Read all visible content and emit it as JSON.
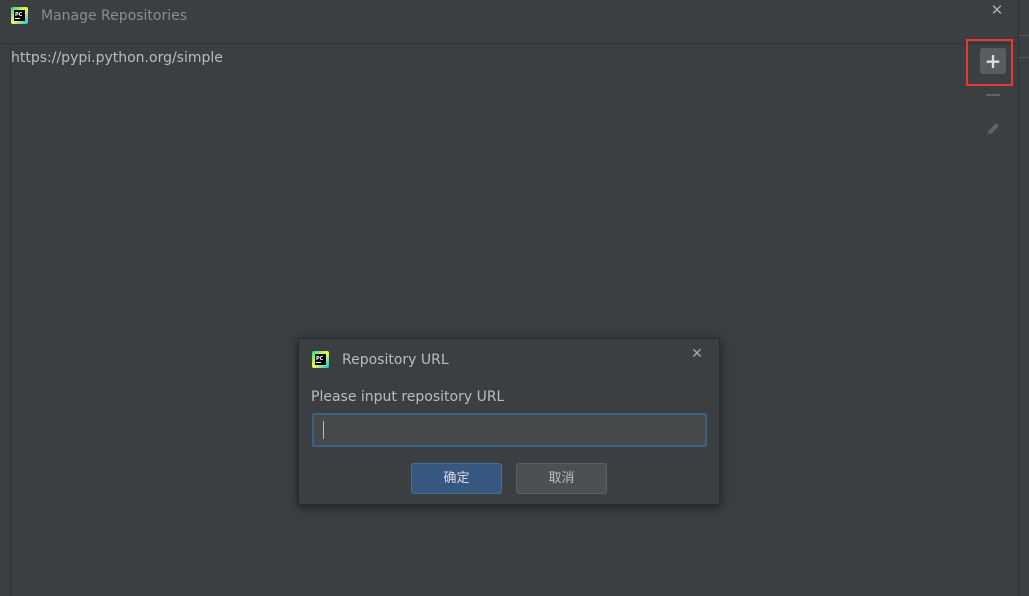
{
  "window": {
    "title": "Manage Repositories",
    "close_glyph": "✕"
  },
  "repositories": {
    "items": [
      {
        "url": "https://pypi.python.org/simple"
      }
    ]
  },
  "toolbar": {
    "add_glyph": "+",
    "add_icon": "plus-icon",
    "remove_icon": "minus-icon",
    "edit_icon": "pencil-icon"
  },
  "dialog": {
    "title": "Repository URL",
    "close_glyph": "✕",
    "label": "Please input repository URL",
    "input_value": "",
    "ok_label": "确定",
    "cancel_label": "取消"
  },
  "colors": {
    "background": "#3c3f41",
    "text": "#bbbbbb",
    "accent_button": "#365880",
    "focus_border": "#3d6185",
    "highlight": "#e53935"
  }
}
